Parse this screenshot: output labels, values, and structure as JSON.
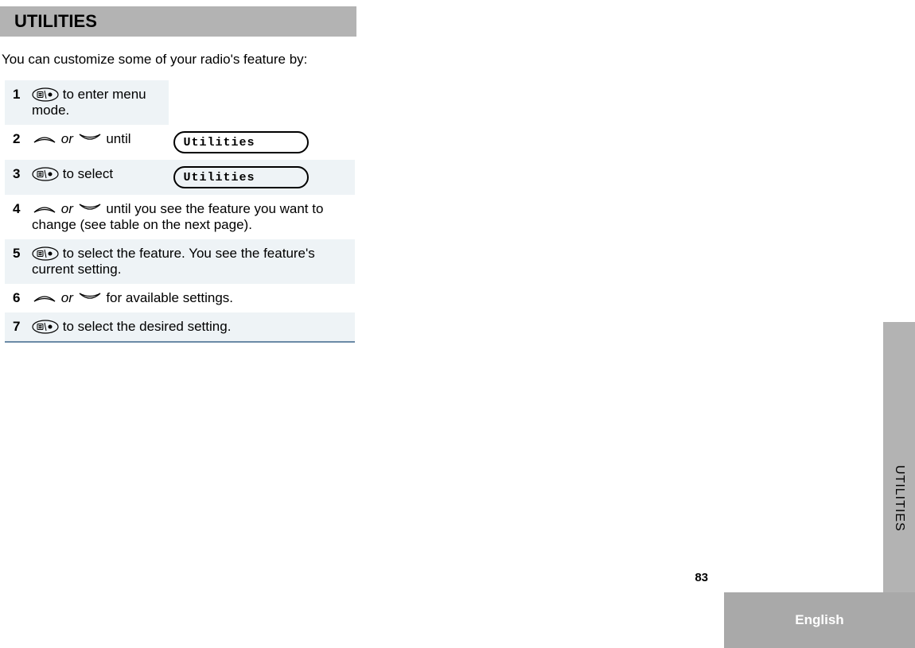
{
  "title": "UTILITIES",
  "intro": "You can customize some of your radio's feature by:",
  "steps": [
    {
      "num": "1",
      "text_parts": [
        "",
        " to enter menu mode."
      ],
      "icon_seq": [
        "menu"
      ],
      "display": null,
      "shaded": true
    },
    {
      "num": "2",
      "text_parts": [
        "",
        " or ",
        " until"
      ],
      "icon_seq": [
        "up",
        "down"
      ],
      "display": "Utilities",
      "shaded": false
    },
    {
      "num": "3",
      "text_parts": [
        "",
        " to select"
      ],
      "icon_seq": [
        "menu"
      ],
      "display": "Utilities",
      "shaded": true
    },
    {
      "num": "4",
      "text_parts": [
        "",
        "  or  ",
        " until you see the feature you want to change (see table on the next page)."
      ],
      "icon_seq": [
        "up",
        "down"
      ],
      "display": null,
      "shaded": false
    },
    {
      "num": "5",
      "text_parts": [
        "",
        " to select the feature. You see the feature's current setting."
      ],
      "icon_seq": [
        "menu"
      ],
      "display": null,
      "shaded": true
    },
    {
      "num": "6",
      "text_parts": [
        "",
        "  or  ",
        "   for available settings."
      ],
      "icon_seq": [
        "up",
        "down"
      ],
      "display": null,
      "shaded": false
    },
    {
      "num": "7",
      "text_parts": [
        "",
        " to select the desired setting."
      ],
      "icon_seq": [
        "menu"
      ],
      "display": null,
      "shaded": true
    }
  ],
  "side_tab": "UTILITIES",
  "page_number": "83",
  "language": "English"
}
